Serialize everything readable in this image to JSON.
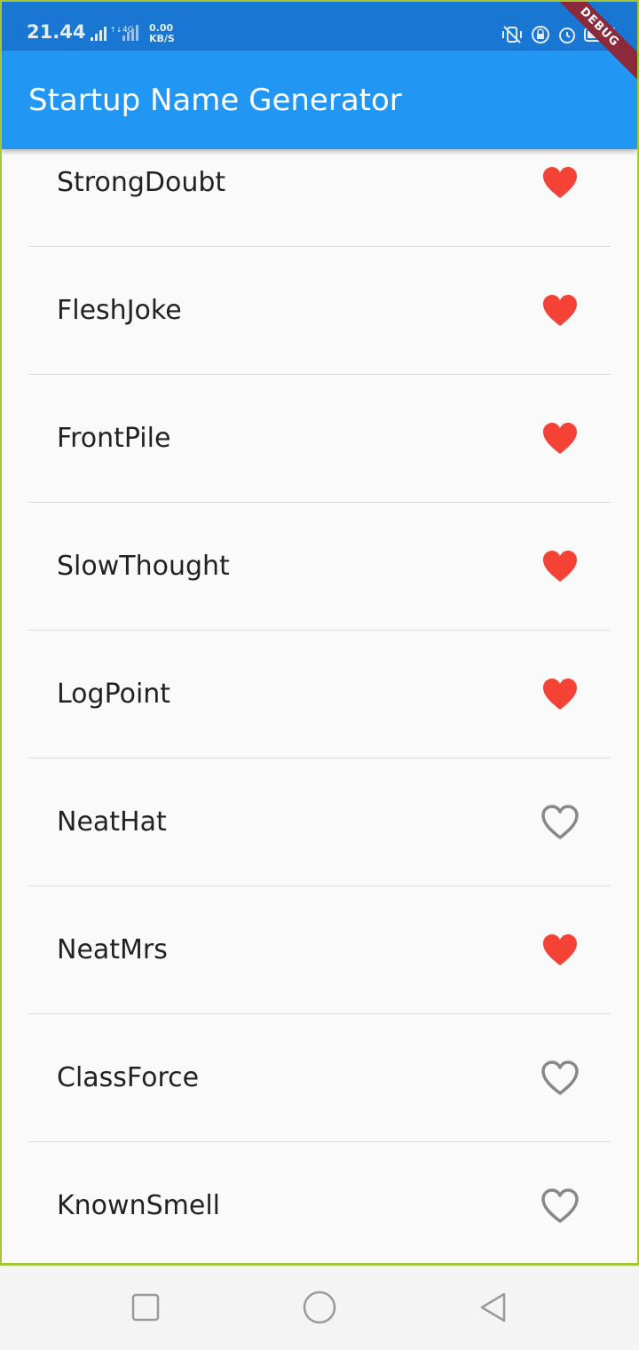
{
  "status_bar": {
    "time": "21.44",
    "network_type": "4G",
    "net_speed_value": "0.00",
    "net_speed_unit": "KB/S",
    "bg_color": "#1976d2"
  },
  "app_bar": {
    "title": "Startup Name Generator",
    "bg_color": "#2196f3",
    "debug_banner": "DEBUG"
  },
  "list": {
    "items": [
      {
        "label": "StrongDoubt",
        "saved": true
      },
      {
        "label": "FleshJoke",
        "saved": true
      },
      {
        "label": "FrontPile",
        "saved": true
      },
      {
        "label": "SlowThought",
        "saved": true
      },
      {
        "label": "LogPoint",
        "saved": true
      },
      {
        "label": "NeatHat",
        "saved": false
      },
      {
        "label": "NeatMrs",
        "saved": true
      },
      {
        "label": "ClassForce",
        "saved": false
      },
      {
        "label": "KnownSmell",
        "saved": false
      }
    ],
    "saved_icon": "heart-filled-icon",
    "unsaved_icon": "heart-outline-icon",
    "saved_color": "#f44336",
    "unsaved_color": "#888888"
  },
  "nav_bar": {
    "recents_icon": "square-icon",
    "home_icon": "circle-icon",
    "back_icon": "triangle-back-icon"
  }
}
